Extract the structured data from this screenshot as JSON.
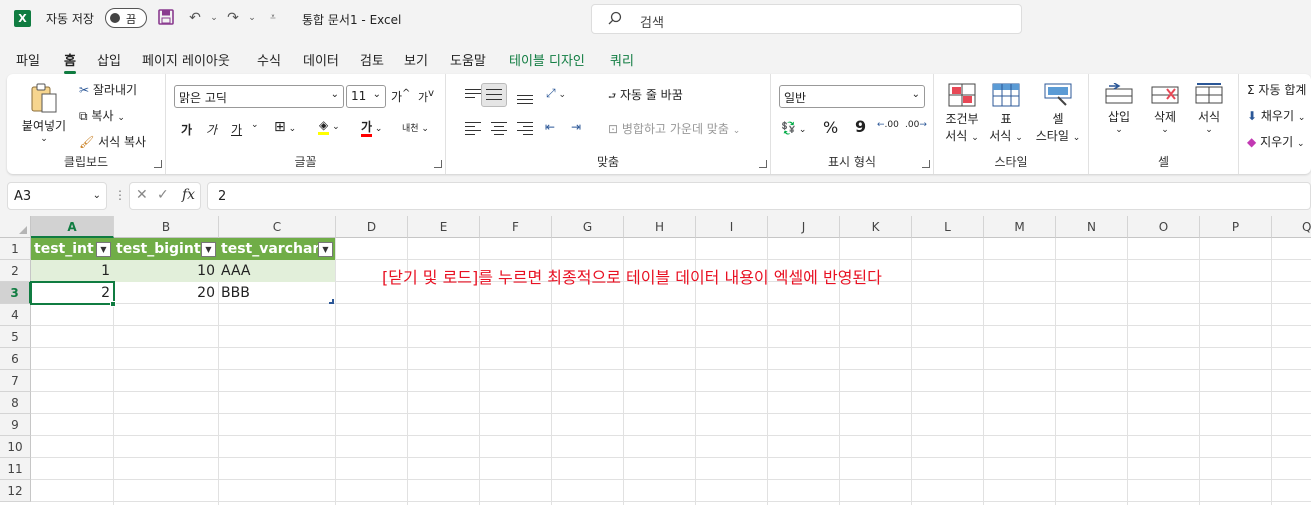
{
  "titlebar": {
    "autosave_label": "자동 저장",
    "autosave_state": "끔",
    "doc_title": "통합 문서1  -  Excel",
    "search_placeholder": "검색"
  },
  "menu": [
    "파일",
    "홈",
    "삽입",
    "페이지 레이아웃",
    "수식",
    "데이터",
    "검토",
    "보기",
    "도움말",
    "테이블 디자인",
    "쿼리"
  ],
  "ribbon": {
    "clipboard": {
      "paste": "붙여넣기",
      "cut": "잘라내기",
      "copy": "복사",
      "format_painter": "서식 복사",
      "label": "클립보드"
    },
    "font": {
      "name": "맑은 고딕",
      "size": "11",
      "grow": "가",
      "shrink": "가",
      "bold": "가",
      "italic": "가",
      "underline": "가",
      "font_color": "가",
      "phonetic": "내천",
      "label": "글꼴"
    },
    "alignment": {
      "wrap_text": "자동 줄 바꿈",
      "merge_center": "병합하고 가운데 맞춤",
      "label": "맞춤"
    },
    "number": {
      "format": "일반",
      "percent": "%",
      "comma": "9",
      "inc_decimal": ".00",
      "dec_decimal": ".00",
      "label": "표시 형식"
    },
    "styles": {
      "conditional": "조건부",
      "conditional2": "서식",
      "table": "표",
      "table2": "서식",
      "cell_styles": "셀",
      "cell_styles2": "스타일",
      "label": "스타일"
    },
    "cells": {
      "insert": "삽입",
      "delete": "삭제",
      "format": "서식",
      "label": "셀"
    },
    "editing": {
      "autosum": "자동 합계",
      "fill": "채우기",
      "clear": "지우기"
    }
  },
  "formula_bar": {
    "name_box": "A3",
    "fx": "fx",
    "value": "2"
  },
  "columns": [
    "A",
    "B",
    "C",
    "D",
    "E",
    "F",
    "G",
    "H",
    "I",
    "J",
    "K",
    "L",
    "M",
    "N",
    "O",
    "P",
    "Q"
  ],
  "rows": [
    "1",
    "2",
    "3",
    "4",
    "5",
    "6",
    "7",
    "8",
    "9",
    "10",
    "11",
    "12"
  ],
  "table": {
    "headers": [
      "test_int",
      "test_bigint",
      "test_varchar"
    ],
    "rows": [
      [
        "1",
        "10",
        "AAA"
      ],
      [
        "2",
        "20",
        "BBB"
      ]
    ]
  },
  "annotation": "[닫기 및 로드]를 누르면 최종적으로 테이블 데이터 내용이 엑셀에 반영된다",
  "colors": {
    "excel_green": "#107c41",
    "table_header": "#70ad47",
    "table_band": "#e2efda",
    "note_red": "#e81123"
  }
}
